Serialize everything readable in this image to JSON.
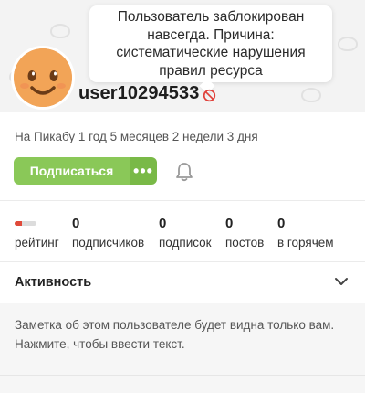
{
  "tooltip": {
    "text": "Пользователь заблокирован навсегда. Причина: систематические нарушения правил ресурса"
  },
  "profile": {
    "username": "user10294533",
    "ban_icon": "ban-icon",
    "since": "На Пикабу 1 год 5 месяцев 2 недели 3 дня",
    "avatar_color": "#f0a35a"
  },
  "actions": {
    "subscribe_label": "Подписаться",
    "more_label": "•••",
    "bell_icon": "bell-icon",
    "accent": "#8ac858"
  },
  "stats": {
    "rating": {
      "label": "рейтинг",
      "level_fraction": 0.35,
      "color": "#e04a3a"
    },
    "subscribers": {
      "value": "0",
      "label": "подписчиков"
    },
    "subscriptions": {
      "value": "0",
      "label": "подписок"
    },
    "posts": {
      "value": "0",
      "label": "постов"
    },
    "hot": {
      "value": "0",
      "label": "в горячем"
    }
  },
  "activity": {
    "title": "Активность",
    "chevron_icon": "chevron-down-icon"
  },
  "note": {
    "text": "Заметка об этом пользователе будет видна только вам. Нажмите, чтобы ввести текст."
  }
}
